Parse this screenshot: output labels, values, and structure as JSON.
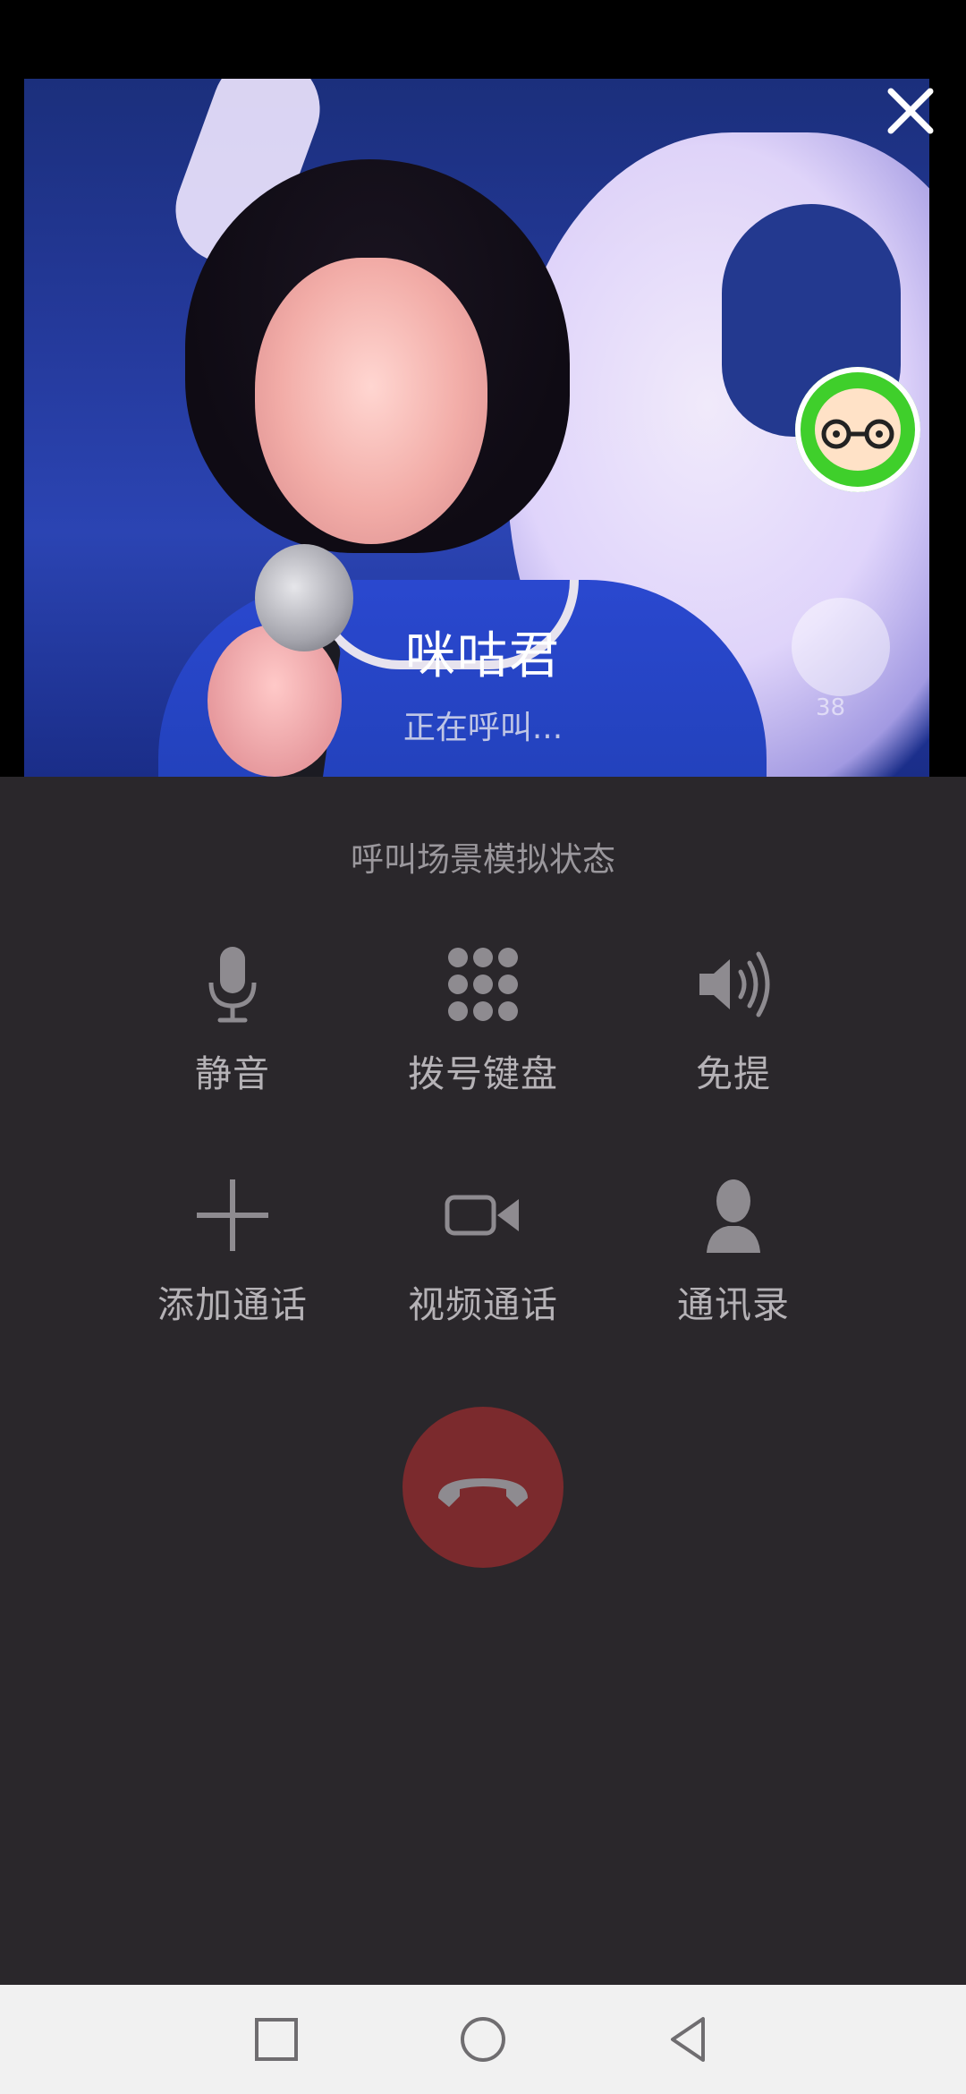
{
  "call": {
    "caller_name": "咪咕君",
    "status": "正在呼叫...",
    "scene_label": "呼叫场景模拟状态",
    "close_icon": "close-icon",
    "video_overlay": {
      "like_count": "38"
    }
  },
  "controls": [
    {
      "id": "mute",
      "label": "静音",
      "icon": "microphone-icon"
    },
    {
      "id": "keypad",
      "label": "拨号键盘",
      "icon": "dialpad-icon"
    },
    {
      "id": "speaker",
      "label": "免提",
      "icon": "speaker-icon"
    },
    {
      "id": "add-call",
      "label": "添加通话",
      "icon": "plus-icon"
    },
    {
      "id": "video-call",
      "label": "视频通话",
      "icon": "video-camera-icon"
    },
    {
      "id": "contacts",
      "label": "通讯录",
      "icon": "person-icon"
    }
  ],
  "hangup": {
    "icon": "hangup-phone-icon",
    "color": "#7b2a2d"
  },
  "navbar": {
    "recents_icon": "square-icon",
    "home_icon": "circle-icon",
    "back_icon": "triangle-back-icon"
  },
  "colors": {
    "background": "#2a272b",
    "label": "#b5b2b6",
    "scene_label": "#9a979c",
    "icon": "#8e8b90",
    "navbar": "#f1f1f1"
  }
}
